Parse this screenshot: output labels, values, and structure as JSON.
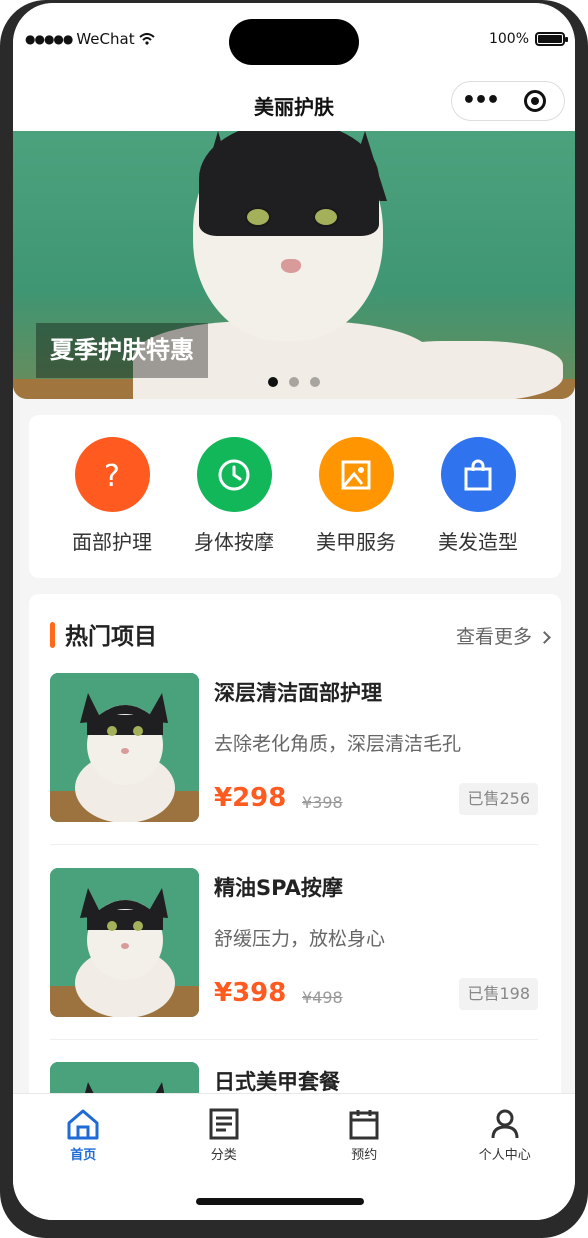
{
  "status": {
    "carrier": "WeChat",
    "battery": "100%"
  },
  "nav": {
    "title": "美丽护肤",
    "more_icon": "ellipsis-icon",
    "close_icon": "target-icon"
  },
  "banner": {
    "caption": "夏季护肤特惠",
    "slide_count": 3,
    "active_index": 0
  },
  "services": [
    {
      "label": "面部护理",
      "icon": "question-icon",
      "color": "#ff5a1f"
    },
    {
      "label": "身体按摩",
      "icon": "clock-icon",
      "color": "#12b75a"
    },
    {
      "label": "美甲服务",
      "icon": "image-icon",
      "color": "#ff9500"
    },
    {
      "label": "美发造型",
      "icon": "bag-icon",
      "color": "#2f74ee"
    }
  ],
  "hot": {
    "title": "热门项目",
    "more_label": "查看更多",
    "items": [
      {
        "name": "深层清洁面部护理",
        "desc": "去除老化角质，深层清洁毛孔",
        "price": "¥298",
        "orig_price": "¥398",
        "sold": "已售256"
      },
      {
        "name": "精油SPA按摩",
        "desc": "舒缓压力，放松身心",
        "price": "¥398",
        "orig_price": "¥498",
        "sold": "已售198"
      },
      {
        "name": "日式美甲套餐",
        "desc": "",
        "price": "",
        "orig_price": "",
        "sold": ""
      }
    ]
  },
  "tabbar": {
    "tabs": [
      {
        "label": "首页",
        "icon": "home-icon",
        "active": true
      },
      {
        "label": "分类",
        "icon": "list-icon",
        "active": false
      },
      {
        "label": "预约",
        "icon": "calendar-icon",
        "active": false
      },
      {
        "label": "个人中心",
        "icon": "user-icon",
        "active": false
      }
    ]
  },
  "colors": {
    "accent": "#ff5a1f",
    "tab_active": "#1e6bd6"
  }
}
